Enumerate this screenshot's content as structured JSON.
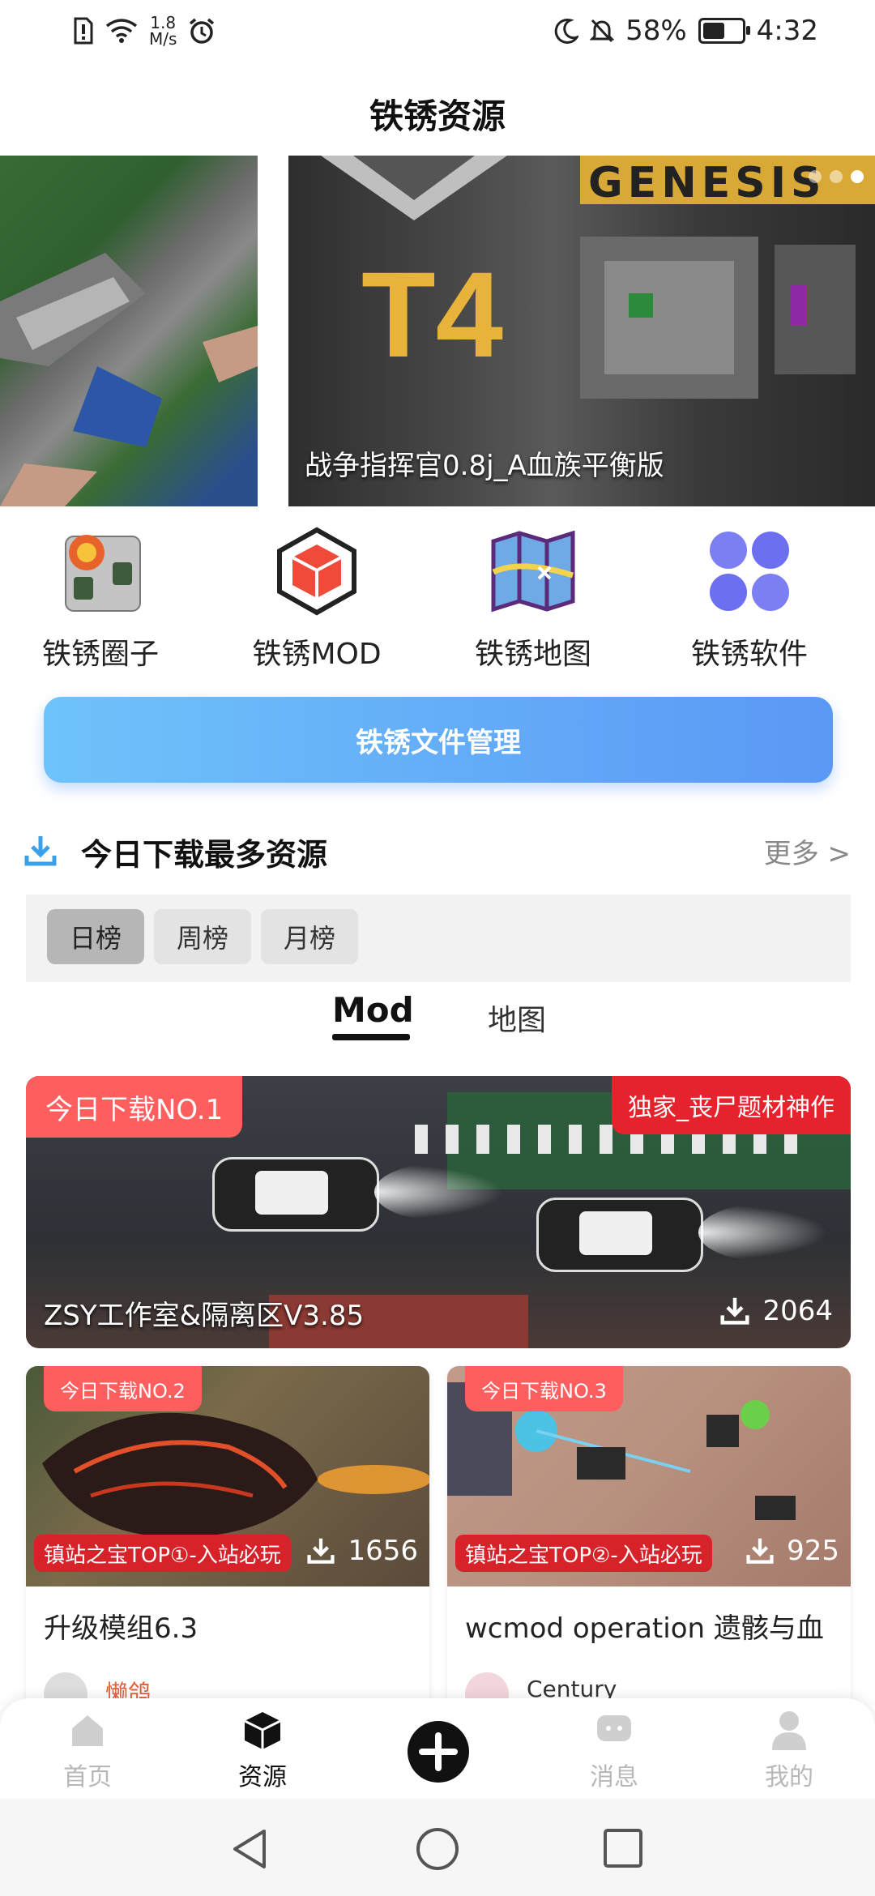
{
  "status_bar": {
    "speed_value": "1.8",
    "speed_unit": "M/s",
    "battery_percent": "58%",
    "battery_level": 0.58,
    "time": "4:32"
  },
  "header": {
    "title": "铁锈资源"
  },
  "banner": {
    "caption": "战争指挥官0.8j_A血族平衡版",
    "art_text_big": "T4",
    "art_text_top": "GENESIS"
  },
  "categories": [
    {
      "label": "铁锈圈子",
      "icon": "tank-circle-icon"
    },
    {
      "label": "铁锈MOD",
      "icon": "hexagon-cube-icon"
    },
    {
      "label": "铁锈地图",
      "icon": "map-icon"
    },
    {
      "label": "铁锈软件",
      "icon": "app-grid-icon"
    }
  ],
  "file_manager": {
    "label": "铁锈文件管理"
  },
  "section": {
    "title": "今日下载最多资源",
    "more": "更多 >"
  },
  "rank_tabs": [
    "日榜",
    "周榜",
    "月榜"
  ],
  "content_tabs": [
    "Mod",
    "地图"
  ],
  "featured": {
    "rank_badge": "今日下载NO.1",
    "exclusive_badge": "独家_丧尸题材神作",
    "name": "ZSY工作室&隔离区V3.85",
    "downloads": "2064"
  },
  "cards": [
    {
      "rank_badge": "今日下载NO.2",
      "tag": "镇站之宝TOP①-入站必玩",
      "downloads": "1656",
      "title": "升级模组6.3",
      "author": "懒鸽",
      "author_color": "#e0603a"
    },
    {
      "rank_badge": "今日下载NO.3",
      "tag": "镇站之宝TOP②-入站必玩",
      "downloads": "925",
      "title": "wcmod operation 遗骸与血",
      "author": "Century",
      "author_color": "#333333"
    }
  ],
  "bottom_nav": [
    {
      "label": "首页",
      "icon": "home-icon"
    },
    {
      "label": "资源",
      "icon": "cube-icon"
    },
    {
      "label": "消息",
      "icon": "message-icon"
    },
    {
      "label": "我的",
      "icon": "user-icon"
    }
  ],
  "colors": {
    "accent_red": "#ff5e5e",
    "tag_red": "#d8222a",
    "button_gradient_start": "#6fc3fb",
    "button_gradient_end": "#5a98f5"
  }
}
